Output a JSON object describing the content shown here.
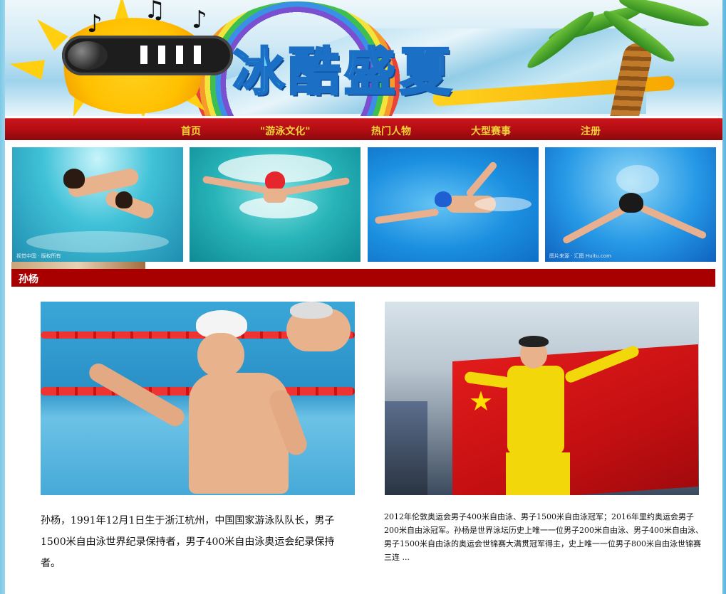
{
  "banner": {
    "title": "冰酷盛夏",
    "alt_subject": "sun-with-sunglasses"
  },
  "nav": {
    "items": [
      {
        "label": "首页"
      },
      {
        "label": "\"游泳文化\""
      },
      {
        "label": "热门人物"
      },
      {
        "label": "大型赛事"
      },
      {
        "label": "注册"
      }
    ],
    "text_color": "#f3d33a",
    "background": "#b30d13"
  },
  "gallery": {
    "watermarks": [
      "视觉中国 · 版权所有",
      "",
      "",
      "图片来源 · 汇图 Huitu.com"
    ]
  },
  "section": {
    "title": "孙杨",
    "bar_color": "#a80000"
  },
  "articles": [
    {
      "photo": "sun-yang-celebrating-in-pool",
      "caption": "孙杨，1991年12月1日生于浙江杭州，中国国家游泳队队长，男子1500米自由泳世界纪录保持者，男子400米自由泳奥运会纪录保持者。"
    },
    {
      "photo": "sun-yang-with-chinese-flag",
      "caption": " 2012年伦敦奥运会男子400米自由泳、男子1500米自由泳冠军；2016年里约奥运会男子200米自由泳冠军。孙杨是世界泳坛历史上唯一一位男子200米自由泳、男子400米自由泳、男子1500米自由泳的奥运会世锦赛大满贯冠军得主，史上唯一一位男子800米自由泳世锦赛三连 ..."
    }
  ]
}
